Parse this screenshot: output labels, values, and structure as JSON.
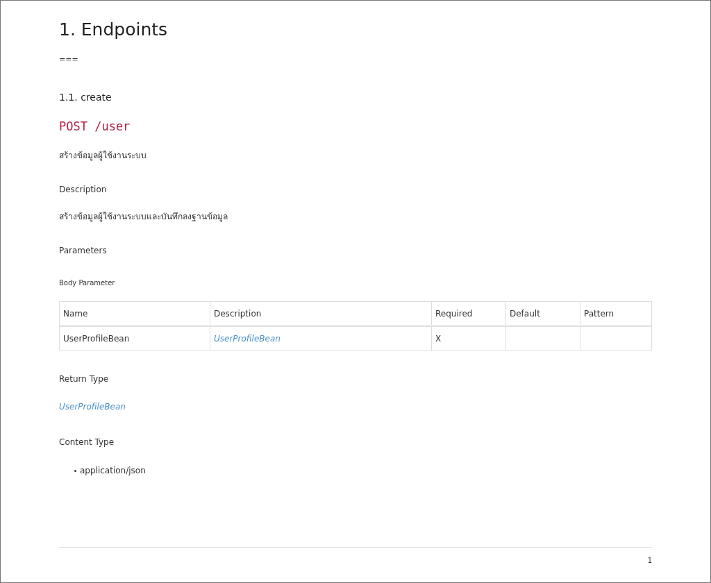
{
  "title": "1. Endpoints",
  "separator": "===",
  "section": {
    "title": "1.1. create",
    "method": "POST",
    "path": "/user",
    "summary": "สร้างข้อมูลผู้ใช้งานระบบ",
    "description_heading": "Description",
    "description": "สร้างข้อมูลผู้ใช้งานระบบและบันทึกลงฐานข้อมูล",
    "parameters_heading": "Parameters",
    "body_parameter_heading": "Body Parameter",
    "table": {
      "columns": [
        "Name",
        "Description",
        "Required",
        "Default",
        "Pattern"
      ],
      "rows": [
        {
          "name": "UserProfileBean",
          "description": "UserProfileBean",
          "required": "X"
        }
      ]
    },
    "return_type_heading": "Return Type",
    "return_type": "UserProfileBean",
    "content_type_heading": "Content Type",
    "content_types": [
      "application/json"
    ]
  },
  "page_number": "1"
}
